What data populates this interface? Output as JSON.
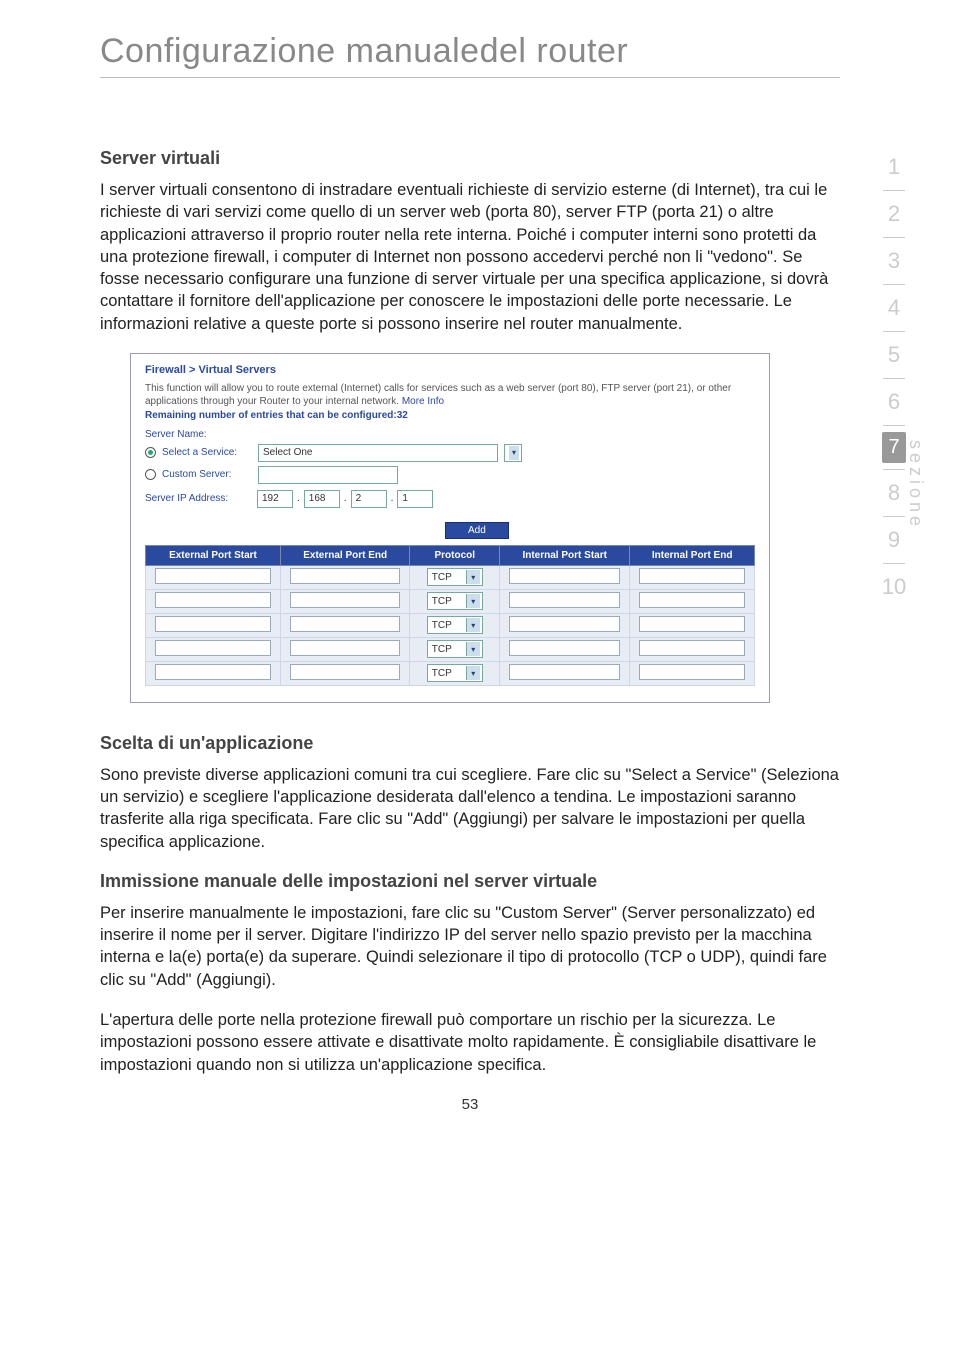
{
  "page_title": "Configurazione manualedel router",
  "sections": {
    "s1": {
      "heading": "Server virtuali",
      "para": "I server virtuali consentono di instradare eventuali richieste di servizio esterne (di Internet), tra cui le richieste di vari servizi come quello di un server web (porta 80), server FTP (porta 21) o altre applicazioni attraverso il proprio router nella rete interna. Poiché i computer interni sono protetti da una protezione firewall, i computer di Internet non possono accedervi perché non li \"vedono\". Se fosse necessario configurare una funzione di server virtuale per una specifica applicazione, si dovrà contattare il fornitore dell'applicazione per conoscere le impostazioni delle porte necessarie. Le informazioni  relative a queste porte si possono  inserire nel router manualmente."
    },
    "s2": {
      "heading": "Scelta di un'applicazione",
      "para": "Sono previste diverse applicazioni comuni tra cui scegliere. Fare clic su \"Select a Service\" (Seleziona un servizio) e scegliere l'applicazione desiderata dall'elenco a tendina. Le impostazioni saranno trasferite alla riga specificata. Fare clic su \"Add\" (Aggiungi) per salvare le impostazioni per quella specifica applicazione."
    },
    "s3": {
      "heading": "Immissione manuale delle impostazioni nel server virtuale",
      "p1": "Per inserire manualmente le impostazioni, fare clic su \"Custom Server\" (Server personalizzato) ed inserire il nome per il server. Digitare l'indirizzo IP del server nello spazio previsto per la macchina interna e la(e) porta(e) da superare. Quindi selezionare il tipo di protocollo (TCP o UDP), quindi fare clic su \"Add\" (Aggiungi).",
      "p2": "L'apertura delle porte nella protezione firewall può comportare un rischio per la sicurezza. Le impostazioni possono essere attivate e disattivate molto rapidamente. È consigliabile disattivare le impostazioni quando non si utilizza un'applicazione specifica."
    }
  },
  "panel": {
    "breadcrumb": "Firewall > Virtual Servers",
    "desc_pre": "This function will allow you to route external (Internet) calls for services such as a web server (port 80), FTP server (port 21), or other applications through your Router to your internal network. ",
    "desc_link": "More Info",
    "remaining": "Remaining number of entries that can be configured:32",
    "server_name_label": "Server Name:",
    "select_service_label": "Select a Service:",
    "select_service_value": "Select One",
    "custom_server_label": "Custom Server:",
    "server_ip_label": "Server IP Address:",
    "ip": [
      "192",
      "168",
      "2",
      "1"
    ],
    "add_btn": "Add",
    "cols": {
      "c1": "External Port Start",
      "c2": "External Port End",
      "c3": "Protocol",
      "c4": "Internal Port Start",
      "c5": "Internal Port End"
    },
    "proto_default": "TCP",
    "row_count": 5
  },
  "sidenav": {
    "items": [
      "1",
      "2",
      "3",
      "4",
      "5",
      "6",
      "7",
      "8",
      "9",
      "10"
    ],
    "active_index": 6,
    "vtext": "sezione"
  },
  "page_number": "53"
}
